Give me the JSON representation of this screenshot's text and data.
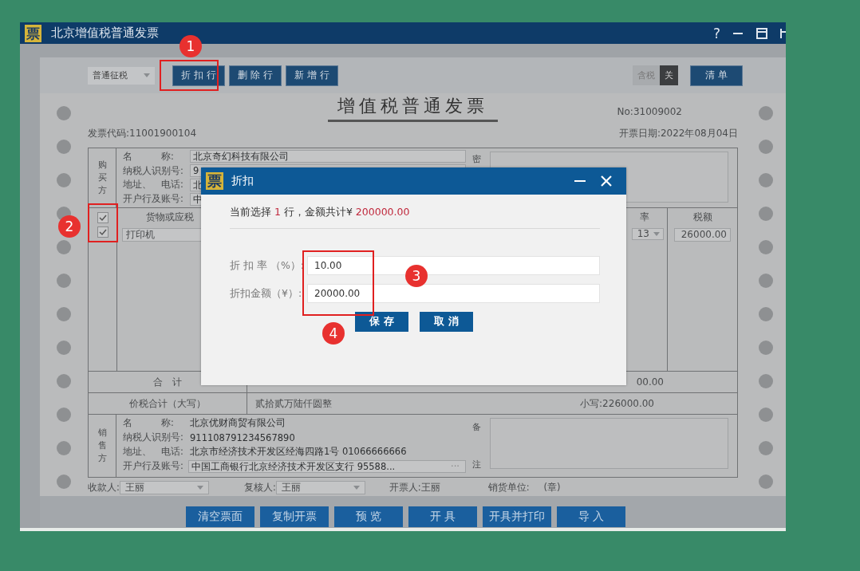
{
  "window": {
    "logo": "票",
    "title": "北京增值税普通发票",
    "help": "?"
  },
  "toolbar": {
    "tax_mode": "普通征税",
    "buttons": [
      "折 扣 行",
      "删 除 行",
      "新 增 行"
    ],
    "tax_included": {
      "label": "含税",
      "state_label": "关",
      "on": false
    },
    "list_button": "清 单"
  },
  "invoice": {
    "title": "增值税普通发票",
    "number": "No:31009002",
    "code": "发票代码:11001900104",
    "date": "开票日期:2022年08月04日",
    "buyer": {
      "label": "购买方",
      "fields": [
        {
          "label": "名　　　称:",
          "value": "北京奇幻科技有限公司"
        },
        {
          "label": "纳税人识别号:",
          "value": "9"
        },
        {
          "label": "地址、　电话:",
          "value": "北"
        },
        {
          "label": "开户行及账号:",
          "value": "中"
        }
      ],
      "cipher_label": "密"
    },
    "items": {
      "select_all": {
        "checked": true
      },
      "columns": [
        "货物或应税",
        "率",
        "税额"
      ],
      "rows": [
        {
          "checked": true,
          "name": "打印机",
          "rate": "13",
          "tax": "26000.00"
        }
      ]
    },
    "total": {
      "label": "合　计",
      "amount": "00.00"
    },
    "grand_total": {
      "label": "价税合计（大写）",
      "words": "贰拾贰万陆仟圆整",
      "figures": "小写:226000.00"
    },
    "seller": {
      "label": "销售方",
      "fields": [
        {
          "label": "名　　　称:",
          "value": "北京优财商贸有限公司"
        },
        {
          "label": "纳税人识别号:",
          "value": "911108791234567890"
        },
        {
          "label": "地址、　电话:",
          "value": "北京市经济技术开发区经海四路1号 01066666666"
        },
        {
          "label": "开户行及账号:",
          "value": "中国工商银行北京经济技术开发区支行 95588...",
          "more": "···"
        }
      ],
      "remarks_label": [
        "备",
        "注"
      ]
    },
    "payee": {
      "label": "收款人:",
      "value": "王丽"
    },
    "reviewer": {
      "label": "复核人:",
      "value": "王丽"
    },
    "issuer": "开票人:王丽",
    "seal": {
      "label": "销货单位:",
      "value": "(章)"
    }
  },
  "actions": [
    "清空票面",
    "复制开票",
    "预 览",
    "开 具",
    "开具并打印",
    "导 入"
  ],
  "dialog": {
    "logo": "票",
    "title": "折扣",
    "info": [
      {
        "text": "当前选择 ",
        "highlight": false
      },
      {
        "text": "1",
        "highlight": true
      },
      {
        "text": " 行，金额共计¥ ",
        "highlight": false
      },
      {
        "text": "200000.00",
        "highlight": true
      }
    ],
    "fields": [
      {
        "label": "折 扣 率 （%）:",
        "value": "10.00"
      },
      {
        "label": "折扣金额（¥）:",
        "value": "20000.00"
      }
    ],
    "buttons": [
      "保 存",
      "取 消"
    ]
  },
  "annotations": [
    "1",
    "2",
    "3",
    "4"
  ]
}
